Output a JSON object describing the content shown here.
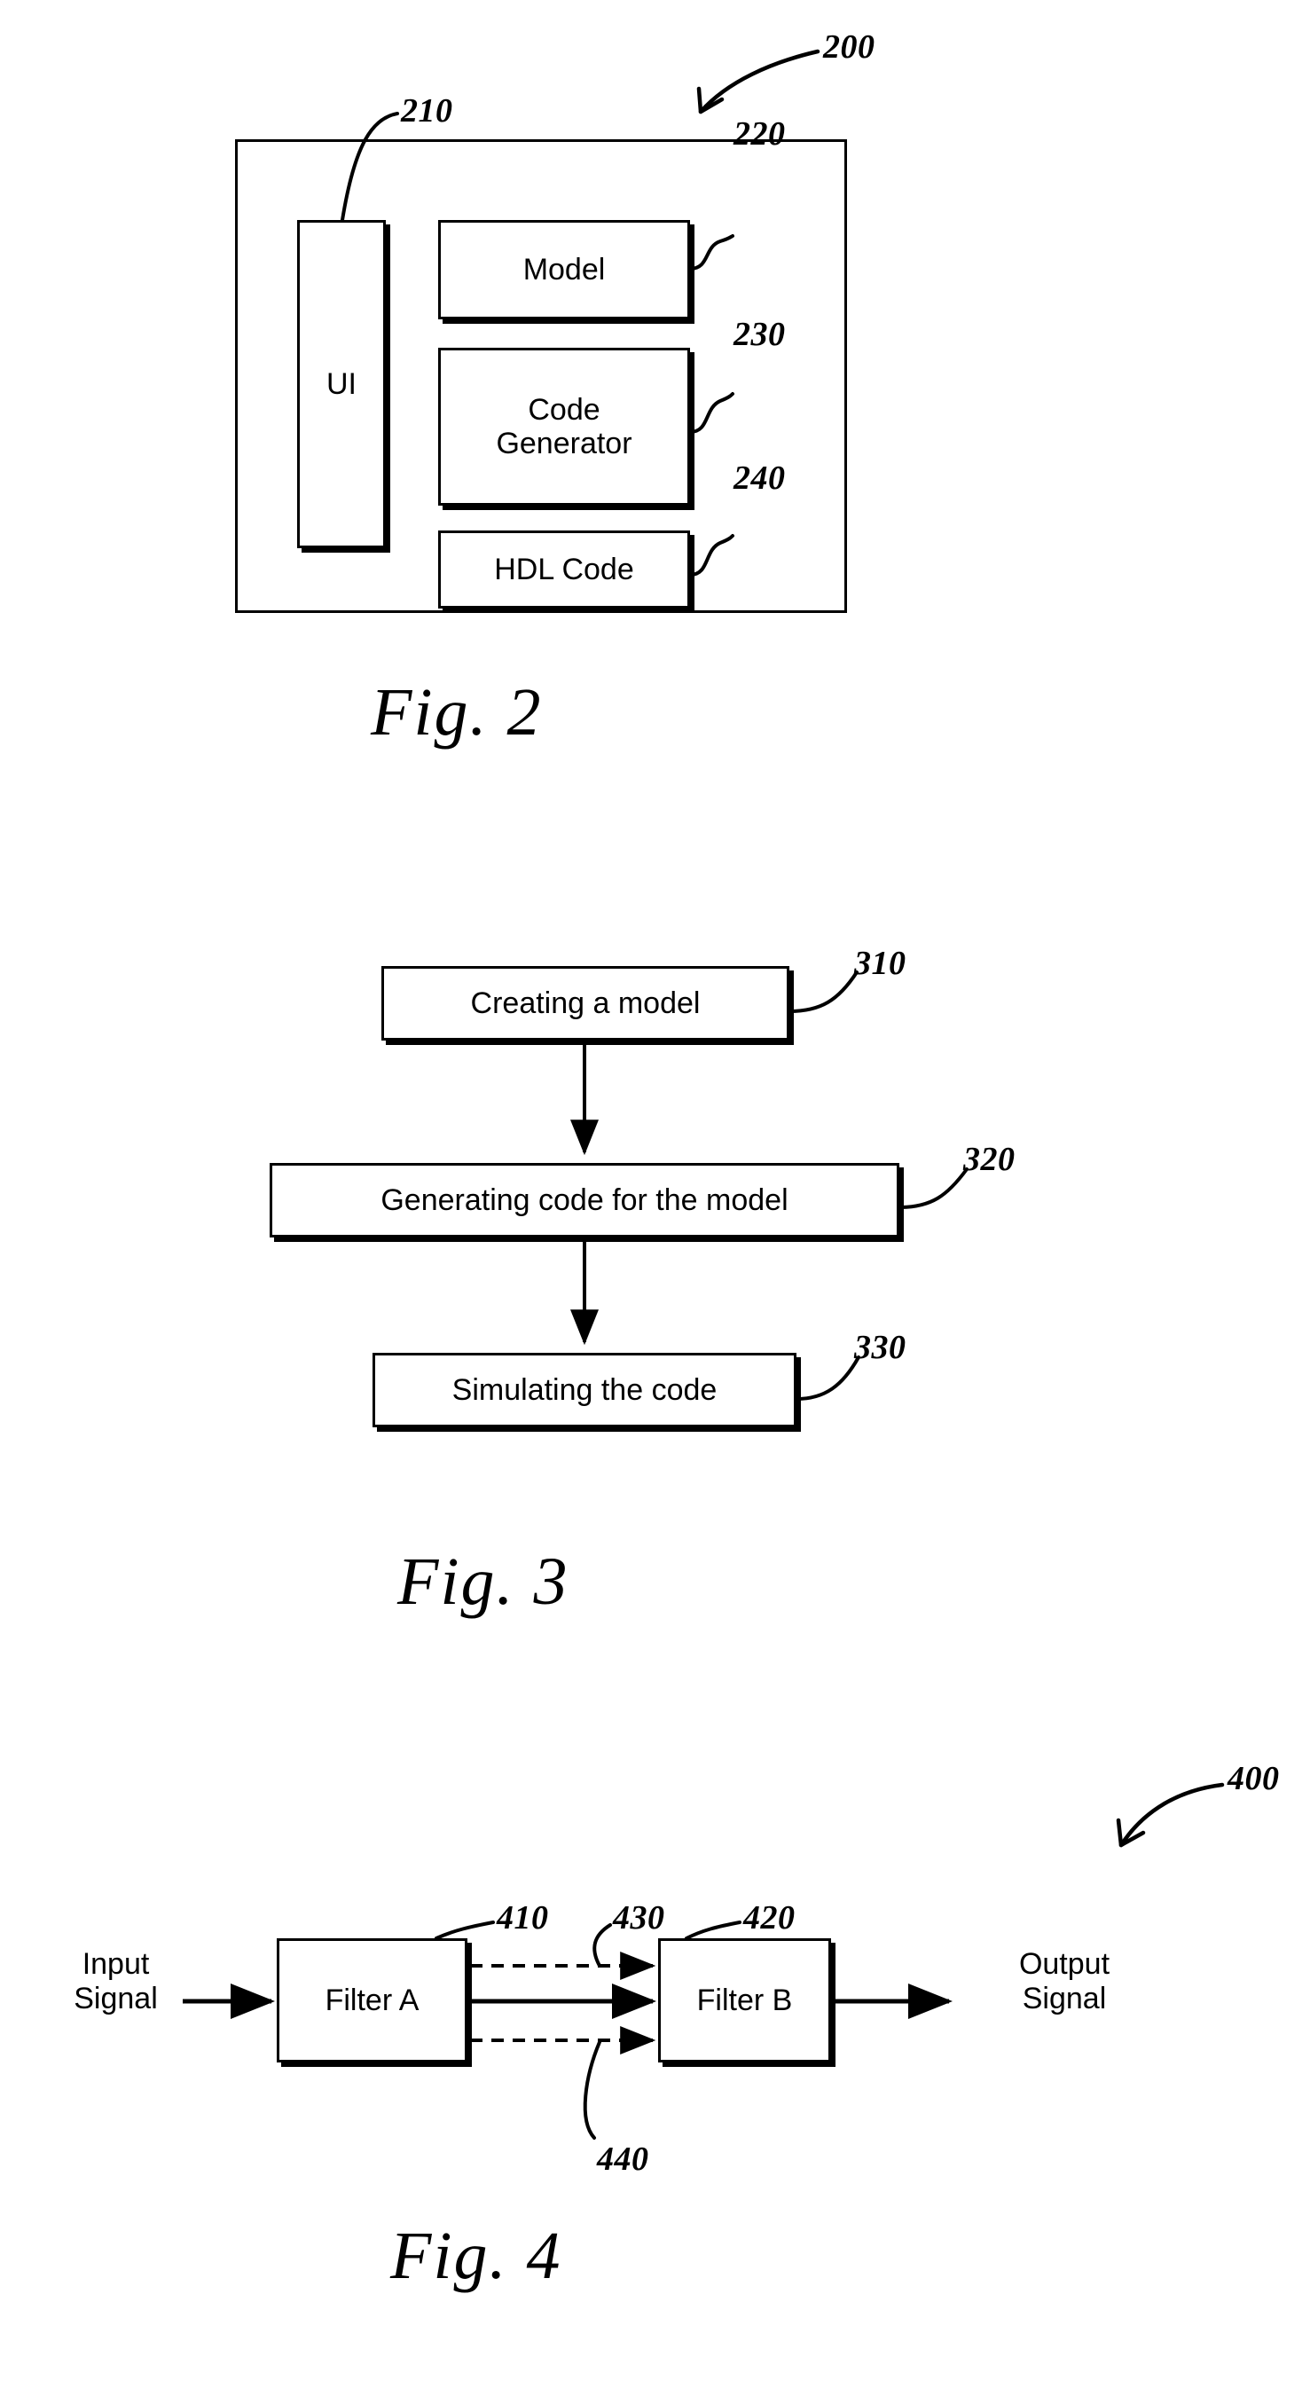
{
  "document": {
    "type": "patent-figure-sheet",
    "background_color": "#ffffff",
    "ink_color": "#000000"
  },
  "figures": [
    {
      "id": "fig2",
      "caption": "Fig. 2",
      "system_ref": "200",
      "blocks": [
        {
          "ref": "210",
          "label": "UI"
        },
        {
          "ref": "220",
          "label": "Model"
        },
        {
          "ref": "230",
          "label": "Code\nGenerator"
        },
        {
          "ref": "240",
          "label": "HDL Code"
        }
      ]
    },
    {
      "id": "fig3",
      "caption": "Fig. 3",
      "steps": [
        {
          "ref": "310",
          "label": "Creating a model"
        },
        {
          "ref": "320",
          "label": "Generating code for the model"
        },
        {
          "ref": "330",
          "label": "Simulating the code"
        }
      ]
    },
    {
      "id": "fig4",
      "caption": "Fig. 4",
      "system_ref": "400",
      "input_label": "Input\nSignal",
      "output_label": "Output\nSignal",
      "blocks": [
        {
          "ref": "410",
          "label": "Filter A"
        },
        {
          "ref": "420",
          "label": "Filter B"
        }
      ],
      "signal_refs": [
        {
          "ref": "430",
          "kind": "dashed-upper-connection"
        },
        {
          "ref": "440",
          "kind": "dashed-lower-connection"
        }
      ]
    }
  ],
  "fig2": {
    "caption": "Fig. 2",
    "ref_200": "200",
    "ref_210": "210",
    "ref_220": "220",
    "ref_230": "230",
    "ref_240": "240",
    "ui_label": "UI",
    "model_label": "Model",
    "code_generator_label": "Code\nGenerator",
    "hdl_code_label": "HDL Code"
  },
  "fig3": {
    "caption": "Fig. 3",
    "ref_310": "310",
    "ref_320": "320",
    "ref_330": "330",
    "step1_label": "Creating a model",
    "step2_label": "Generating code for the model",
    "step3_label": "Simulating the code"
  },
  "fig4": {
    "caption": "Fig. 4",
    "ref_400": "400",
    "ref_410": "410",
    "ref_420": "420",
    "ref_430": "430",
    "ref_440": "440",
    "input_label": "Input\nSignal",
    "output_label": "Output\nSignal",
    "filter_a_label": "Filter A",
    "filter_b_label": "Filter B"
  }
}
